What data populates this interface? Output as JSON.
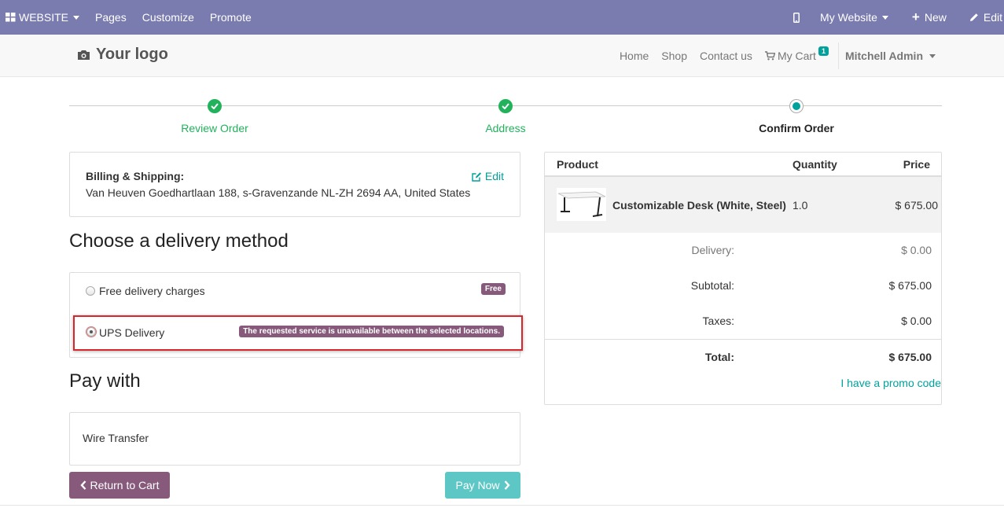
{
  "adminbar": {
    "website_label": "WEBSITE",
    "menu": [
      "Pages",
      "Customize",
      "Promote"
    ],
    "my_website": "My Website",
    "new_label": "New",
    "edit_label": "Edit"
  },
  "header": {
    "logo_text": "Your logo",
    "nav": {
      "home": "Home",
      "shop": "Shop",
      "contact": "Contact us",
      "cart": "My Cart",
      "cart_count": "1"
    },
    "user": "Mitchell Admin"
  },
  "wizard": {
    "steps": [
      {
        "label": "Review Order",
        "state": "done"
      },
      {
        "label": "Address",
        "state": "done"
      },
      {
        "label": "Confirm Order",
        "state": "current"
      }
    ]
  },
  "billing": {
    "title": "Billing & Shipping:",
    "address": "Van Heuven Goedhartlaan 188, s-Gravenzande NL-ZH 2694 AA, United States",
    "edit_label": "Edit"
  },
  "delivery": {
    "heading": "Choose a delivery method",
    "options": [
      {
        "label": "Free delivery charges",
        "badge": "Free",
        "selected": false
      },
      {
        "label": "UPS Delivery",
        "badge": "The requested service is unavailable between the selected locations.",
        "selected": true
      }
    ]
  },
  "payment": {
    "heading": "Pay with",
    "method": "Wire Transfer",
    "return_label": "Return to Cart",
    "pay_label": "Pay Now"
  },
  "order": {
    "columns": {
      "product": "Product",
      "quantity": "Quantity",
      "price": "Price"
    },
    "line": {
      "product": "Customizable Desk (White, Steel)",
      "quantity": "1.0",
      "price": "$ 675.00"
    },
    "delivery_label": "Delivery:",
    "delivery_value": "$ 0.00",
    "subtotal_label": "Subtotal:",
    "subtotal_value": "$ 675.00",
    "taxes_label": "Taxes:",
    "taxes_value": "$ 0.00",
    "total_label": "Total:",
    "total_value": "$ 675.00",
    "promo_label": "I have a promo code"
  },
  "colors": {
    "admin_bar": "#7a7bae",
    "primary": "#875a7b",
    "teal": "#00a09d",
    "green": "#21b25b",
    "error_outline": "#d9262b"
  }
}
